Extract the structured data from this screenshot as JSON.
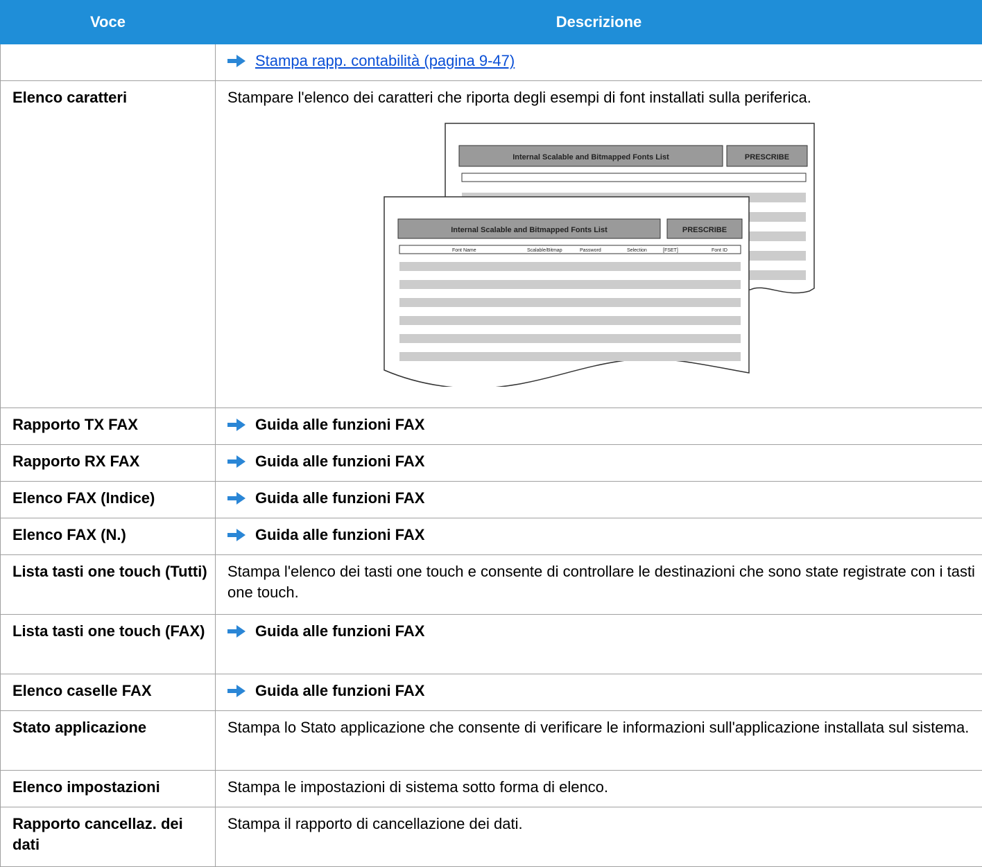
{
  "header": {
    "col1": "Voce",
    "col2": "Descrizione"
  },
  "rows": [
    {
      "item": "",
      "desc": "Stampa rapp. contabilità (pagina 9-47)"
    },
    {
      "item": "Elenco caratteri",
      "desc": "Stampare l'elenco dei caratteri che riporta degli esempi di font installati sulla periferica."
    },
    {
      "item": "Rapporto TX FAX",
      "desc": "Guida alle funzioni FAX"
    },
    {
      "item": "Rapporto RX FAX",
      "desc": "Guida alle funzioni FAX"
    },
    {
      "item": "Elenco FAX (Indice)",
      "desc": "Guida alle funzioni FAX"
    },
    {
      "item": "Elenco FAX (N.)",
      "desc": "Guida alle funzioni FAX"
    },
    {
      "item": "Lista tasti one touch (Tutti)",
      "desc": "Stampa l'elenco dei tasti one touch e consente di controllare le destinazioni che sono state registrate con i tasti one touch."
    },
    {
      "item": "Lista tasti one touch (FAX)",
      "desc": "Guida alle funzioni FAX"
    },
    {
      "item": "Elenco caselle FAX",
      "desc": "Guida alle funzioni FAX"
    },
    {
      "item": "Stato applicazione",
      "desc": "Stampa lo Stato applicazione che consente di verificare le informazioni sull'applicazione installata sul sistema."
    },
    {
      "item": "Elenco impostazioni",
      "desc": "Stampa le impostazioni di sistema sotto forma di elenco."
    },
    {
      "item": "Rapporto cancellaz. dei dati",
      "desc": "Stampa il rapporto di cancellazione dei dati."
    }
  ],
  "figure": {
    "title": "Internal Scalable and Bitmapped Fonts List",
    "badge": "PRESCRIBE",
    "columns": [
      "Font Name",
      "Scalable/Bitmap",
      "Password",
      "Selection",
      "[FSET]",
      "Font ID"
    ]
  },
  "colors": {
    "header": "#1f8ed8",
    "link": "#0a4fd6",
    "arrow": "#2a86d6"
  }
}
